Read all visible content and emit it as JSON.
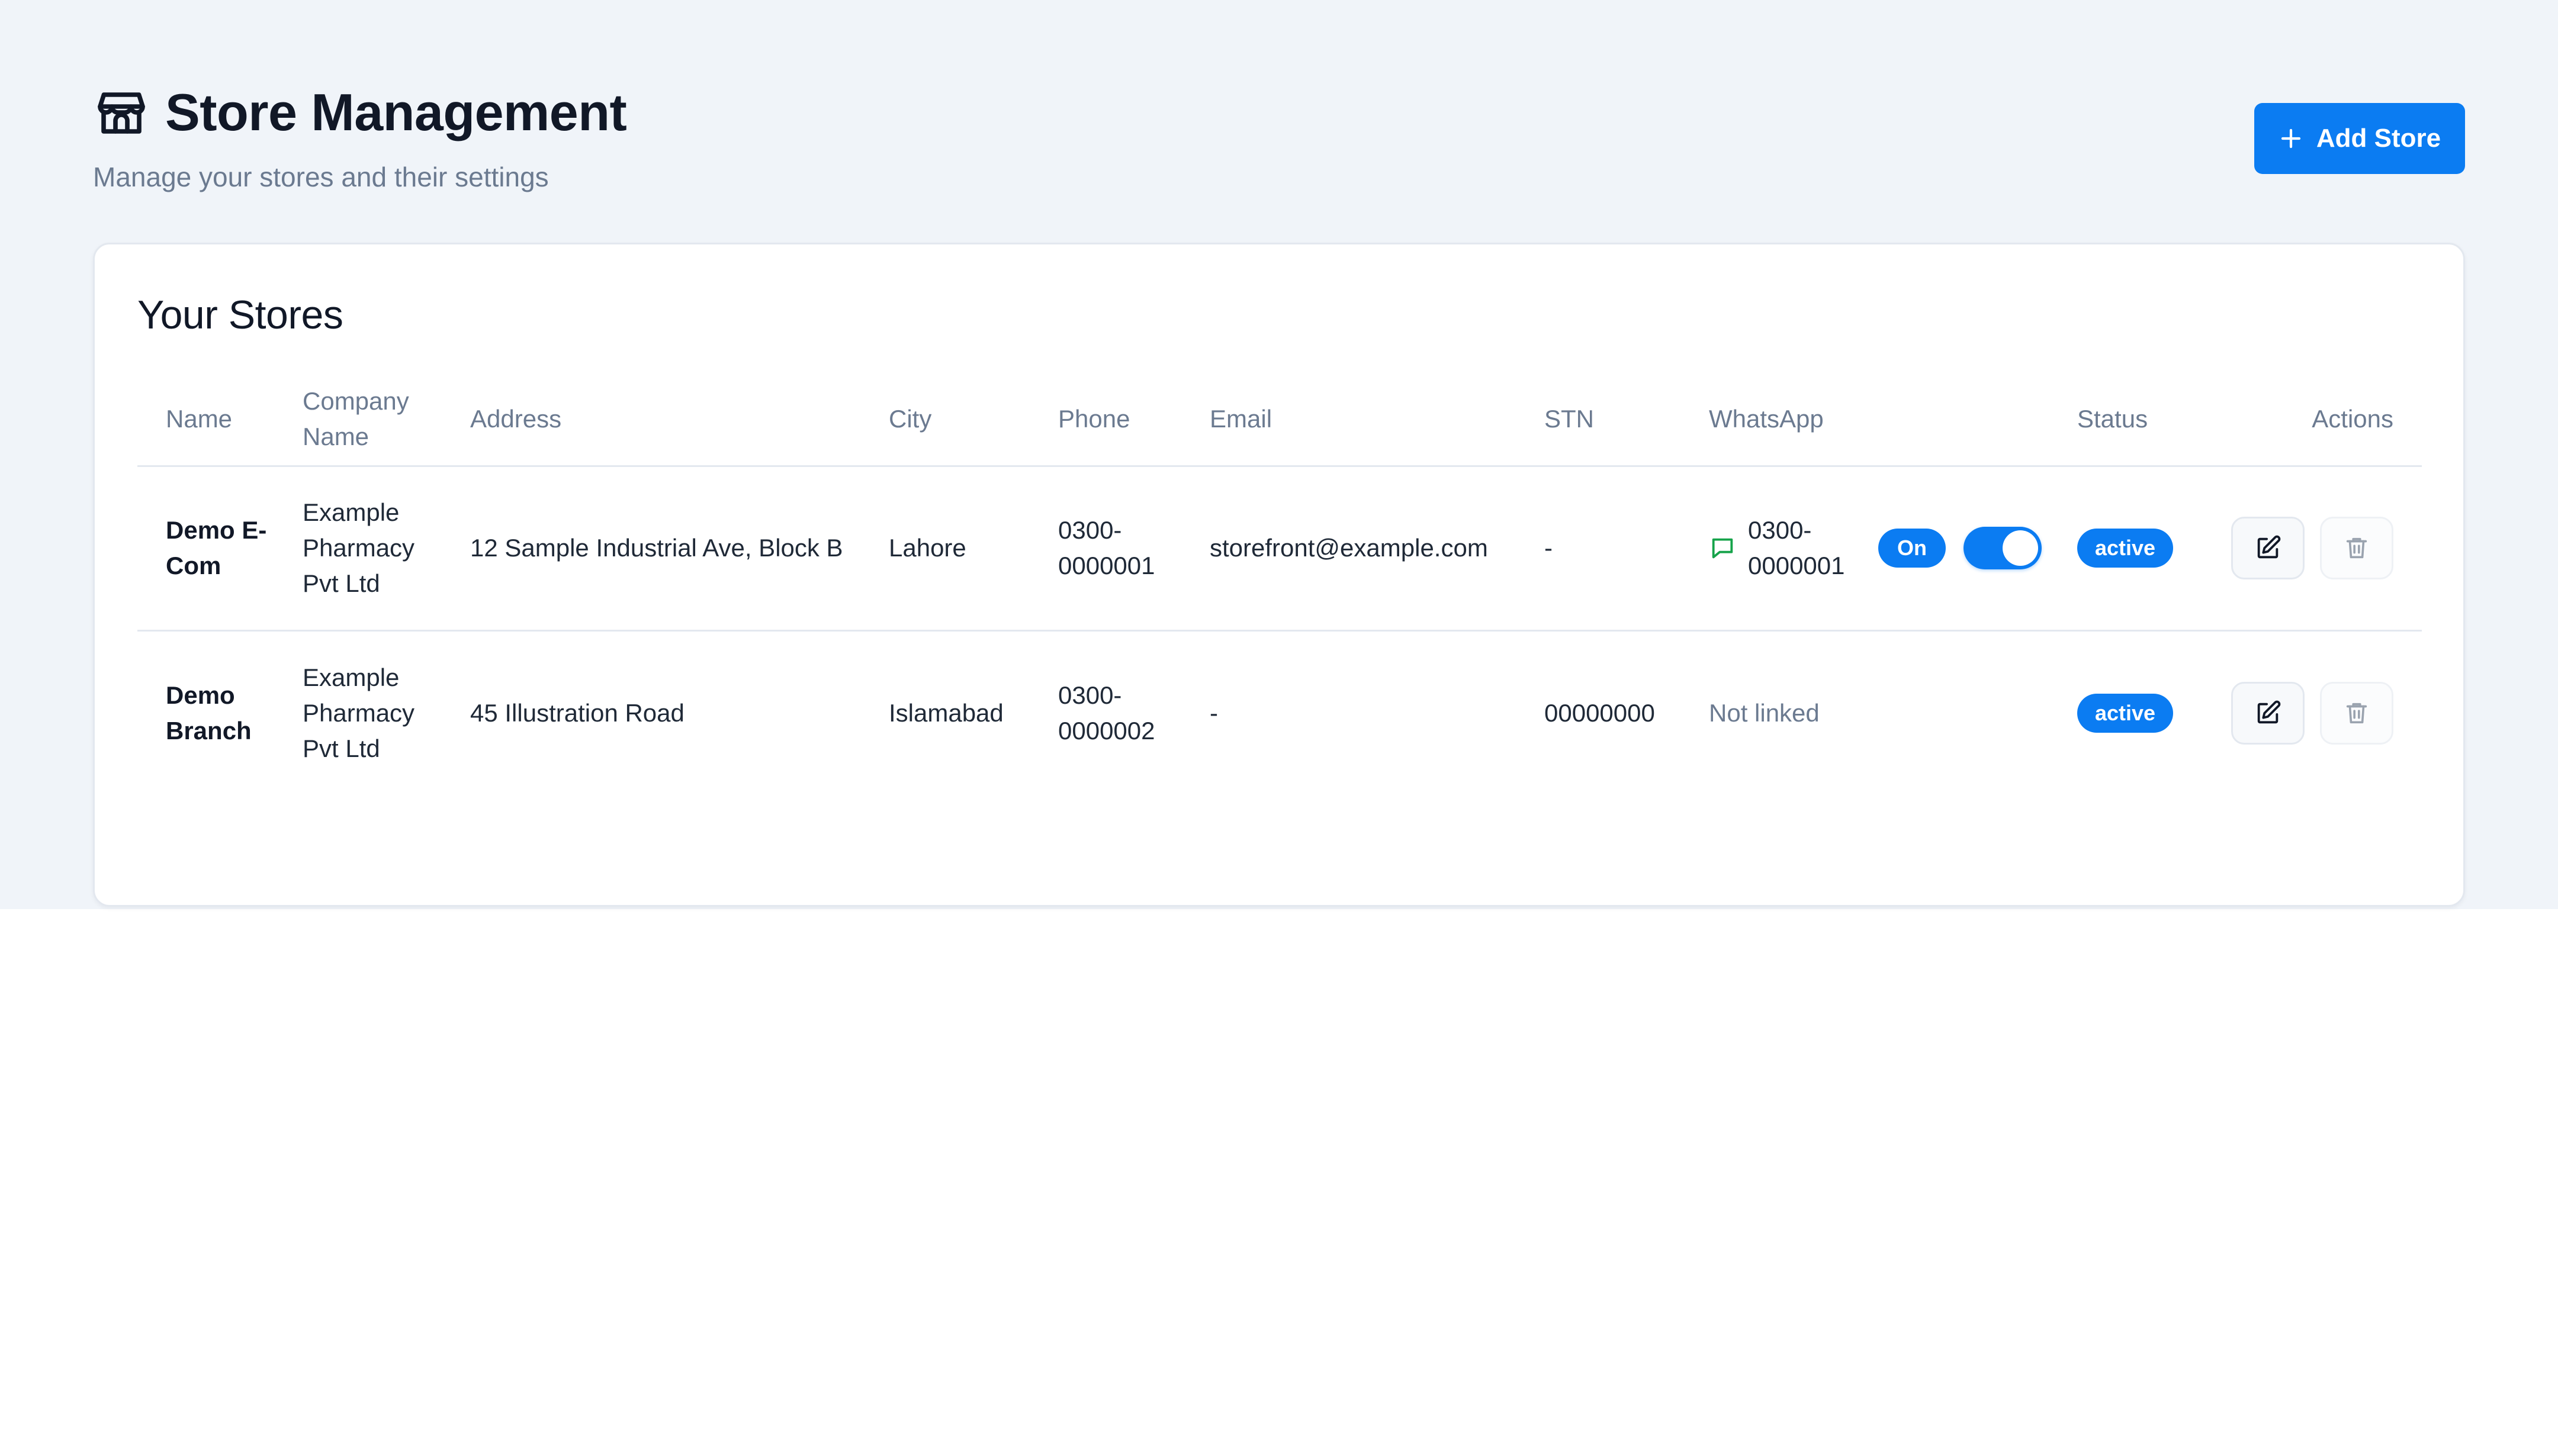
{
  "header": {
    "title": "Store Management",
    "subtitle": "Manage your stores and their settings",
    "icon": "store-icon"
  },
  "add_button": {
    "label": "Add Store",
    "icon": "plus-icon"
  },
  "card": {
    "title": "Your Stores"
  },
  "table": {
    "columns": [
      "Name",
      "Company Name",
      "Address",
      "City",
      "Phone",
      "Email",
      "STN",
      "WhatsApp",
      "Status",
      "Actions"
    ],
    "rows": [
      {
        "name": "Demo E-Com",
        "company": "Example Pharmacy Pvt Ltd",
        "address": "12 Sample Industrial Ave, Block B",
        "city": "Lahore",
        "phone": "0300-0000001",
        "email": "storefront@example.com",
        "stn": "-",
        "whatsapp": {
          "number": "0300-0000001",
          "state_label": "On",
          "enabled": true
        },
        "status": "active"
      },
      {
        "name": "Demo Branch",
        "company": "Example Pharmacy Pvt Ltd",
        "address": "45 Illustration Road",
        "city": "Islamabad",
        "phone": "0300-0000002",
        "email": "-",
        "stn": "00000000",
        "whatsapp": {
          "text": "Not linked"
        },
        "status": "active"
      }
    ]
  },
  "colors": {
    "accent": "#0b7cf2",
    "page_bg": "#f0f4f9",
    "whatsapp_icon": "#16a34a",
    "muted_text": "#6b7a90"
  }
}
